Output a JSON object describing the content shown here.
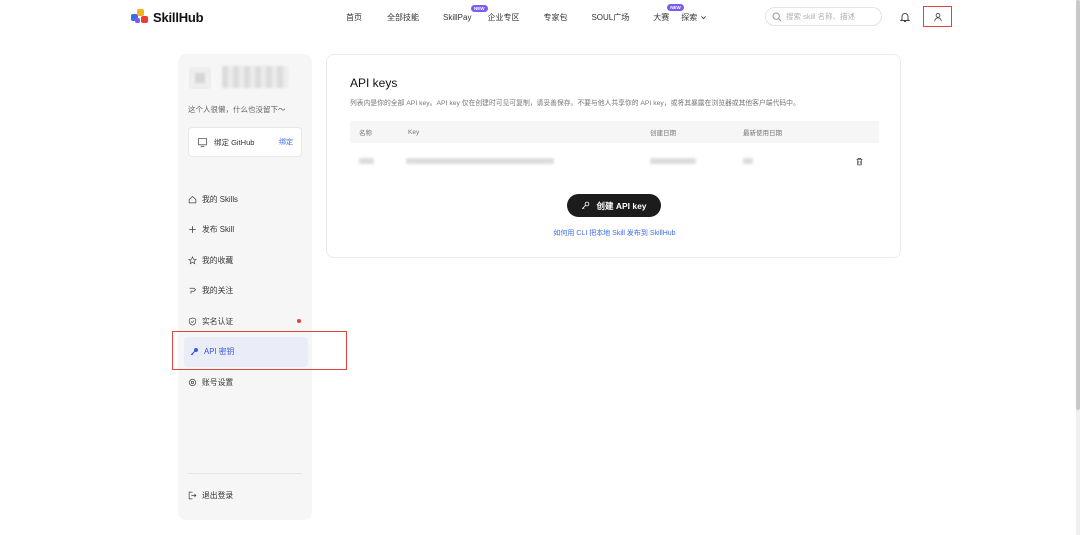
{
  "header": {
    "logo_text": "SkillHub",
    "nav": [
      {
        "label": "首页",
        "badge": ""
      },
      {
        "label": "全部技能",
        "badge": ""
      },
      {
        "label": "SkillPay",
        "badge": "NEW"
      },
      {
        "label": "企业专区",
        "badge": ""
      },
      {
        "label": "专家包",
        "badge": ""
      },
      {
        "label": "SOUL广场",
        "badge": ""
      },
      {
        "label": "大赛",
        "badge": "NEW"
      },
      {
        "label": "探索",
        "badge": ""
      }
    ],
    "search_placeholder": "搜索 skill 名称、描述"
  },
  "sidebar": {
    "bio": "这个人很懒，什么也没留下～",
    "github_card": {
      "label": "绑定 GitHub",
      "action": "绑定"
    },
    "menu": [
      {
        "label": "我的 Skills",
        "icon": "home-icon"
      },
      {
        "label": "发布 Skill",
        "icon": "plus-icon"
      },
      {
        "label": "我的收藏",
        "icon": "star-icon"
      },
      {
        "label": "我的关注",
        "icon": "follow-icon"
      },
      {
        "label": "实名认证",
        "icon": "shield-check-icon",
        "alert_dot": true
      },
      {
        "label": "API 密钥",
        "icon": "key-icon",
        "active": true
      },
      {
        "label": "账号设置",
        "icon": "gear-icon"
      }
    ],
    "logout": "退出登录"
  },
  "main": {
    "title": "API keys",
    "description": "列表内是你的全部 API key。API key 仅在创建时可见可复制，请妥善保存。不要与他人共享你的 API key，或将其暴露在浏览器或其他客户端代码中。",
    "table": {
      "columns": [
        "名称",
        "Key",
        "创建日期",
        "最新使用日期"
      ]
    },
    "create_button": "创建 API key",
    "cli_link": "如何用 CLI 把本地 Skill 发布到 SkillHub"
  },
  "colors": {
    "accent_blue": "#3d6be8",
    "highlight_red": "#e0443a",
    "badge_purple": "#7b5cf2",
    "button_dark": "#1c1c1c"
  }
}
